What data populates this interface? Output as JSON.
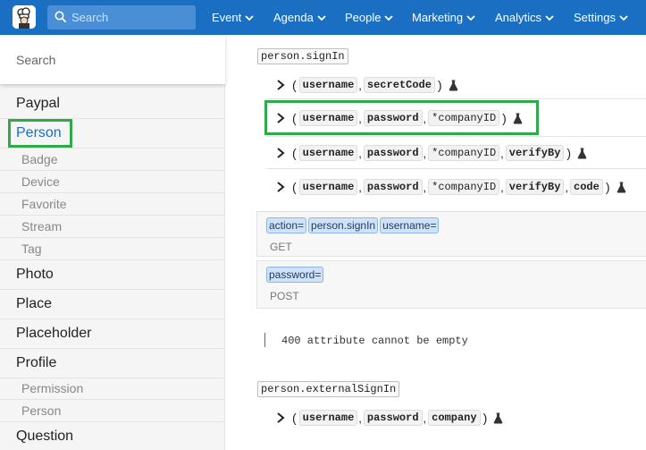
{
  "topbar": {
    "search_placeholder": "Search",
    "nav": [
      {
        "label": "Event"
      },
      {
        "label": "Agenda"
      },
      {
        "label": "People"
      },
      {
        "label": "Marketing"
      },
      {
        "label": "Analytics"
      },
      {
        "label": "Settings"
      }
    ]
  },
  "sidebar": {
    "search_placeholder": "Search",
    "items": [
      {
        "label": "Paypal"
      },
      {
        "label": "Person"
      },
      {
        "label": "Badge"
      },
      {
        "label": "Device"
      },
      {
        "label": "Favorite"
      },
      {
        "label": "Stream"
      },
      {
        "label": "Tag"
      },
      {
        "label": "Photo"
      },
      {
        "label": "Place"
      },
      {
        "label": "Placeholder"
      },
      {
        "label": "Profile"
      },
      {
        "label": "Permission"
      },
      {
        "label": "Person"
      },
      {
        "label": "Question"
      }
    ]
  },
  "main": {
    "endpoint1": {
      "title": "person.signIn",
      "signatures": [
        {
          "params": [
            "username",
            "secretCode"
          ]
        },
        {
          "params": [
            "username",
            "password",
            "*companyID"
          ]
        },
        {
          "params": [
            "username",
            "password",
            "*companyID",
            "verifyBy"
          ]
        },
        {
          "params": [
            "username",
            "password",
            "*companyID",
            "verifyBy",
            "code"
          ]
        }
      ]
    },
    "request_get": {
      "tags": [
        "action=",
        "person.signIn",
        "username="
      ],
      "method": "GET"
    },
    "request_post": {
      "tags": [
        "password="
      ],
      "method": "POST"
    },
    "error_text": "400 attribute cannot be empty",
    "endpoint2": {
      "title": "person.externalSignIn",
      "signatures": [
        {
          "params": [
            "username",
            "password",
            "company"
          ]
        }
      ]
    },
    "paren_open": "(",
    "paren_close": ")",
    "comma": ","
  },
  "colors": {
    "topbar_bg": "#1a6fc2",
    "highlight_box": "#2eaa4a",
    "active_link": "#1a6fc2",
    "tag_bg": "#cfe2f7"
  }
}
